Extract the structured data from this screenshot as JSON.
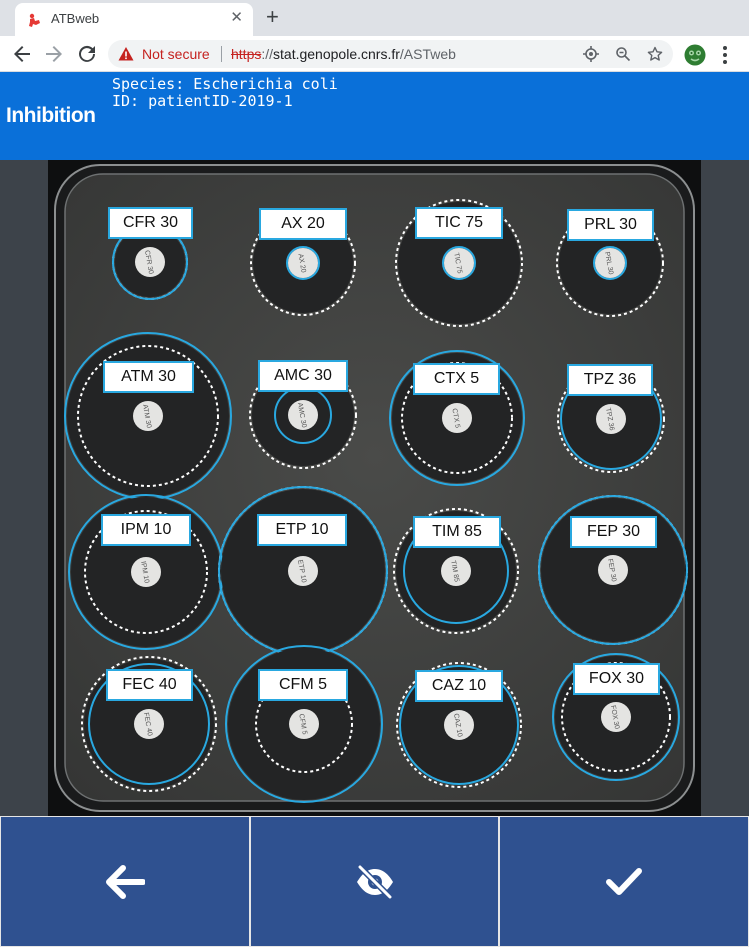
{
  "browser": {
    "tab_title": "ATBweb",
    "close_glyph": "✕",
    "new_tab_glyph": "+",
    "security_label": "Not secure",
    "url_scheme": "https",
    "url_sep": "://",
    "url_host": "stat.genopole.cnrs.fr",
    "url_path": "/ASTweb"
  },
  "header": {
    "title": "Inhibition",
    "species": "Species: Escherichia coli",
    "id": "ID: patientID-2019-1"
  },
  "antibiotics": [
    {
      "label": "CFR 30",
      "disk_text": "CFR 30"
    },
    {
      "label": "AX 20",
      "disk_text": "AX 20"
    },
    {
      "label": "TIC 75",
      "disk_text": "TIC 75"
    },
    {
      "label": "PRL 30",
      "disk_text": "PRL 30"
    },
    {
      "label": "ATM 30",
      "disk_text": "ATM 30"
    },
    {
      "label": "AMC 30",
      "disk_text": "AMC 30"
    },
    {
      "label": "CTX 5",
      "disk_text": "CTX 5"
    },
    {
      "label": "TPZ 36",
      "disk_text": "TPZ 36"
    },
    {
      "label": "IPM 10",
      "disk_text": "IPM 10"
    },
    {
      "label": "ETP 10",
      "disk_text": "ETP 10"
    },
    {
      "label": "TIM 85",
      "disk_text": "TIM 85"
    },
    {
      "label": "FEP 30",
      "disk_text": "FEP 30"
    },
    {
      "label": "FEC 40",
      "disk_text": "FEC 40"
    },
    {
      "label": "CFM 5",
      "disk_text": "CFM 5"
    },
    {
      "label": "CAZ 10",
      "disk_text": "CAZ 10"
    },
    {
      "label": "FOX 30",
      "disk_text": "FOX 30"
    }
  ],
  "actions": {
    "back_icon": "arrow-left-icon",
    "toggle_icon": "eye-off-icon",
    "confirm_icon": "check-icon"
  },
  "colors": {
    "header_bg": "#0a70d9",
    "measured_circle": "#29a8e0",
    "reference_circle": "#ffffff",
    "action_bg": "#2f5190",
    "warning": "#c5221f"
  }
}
